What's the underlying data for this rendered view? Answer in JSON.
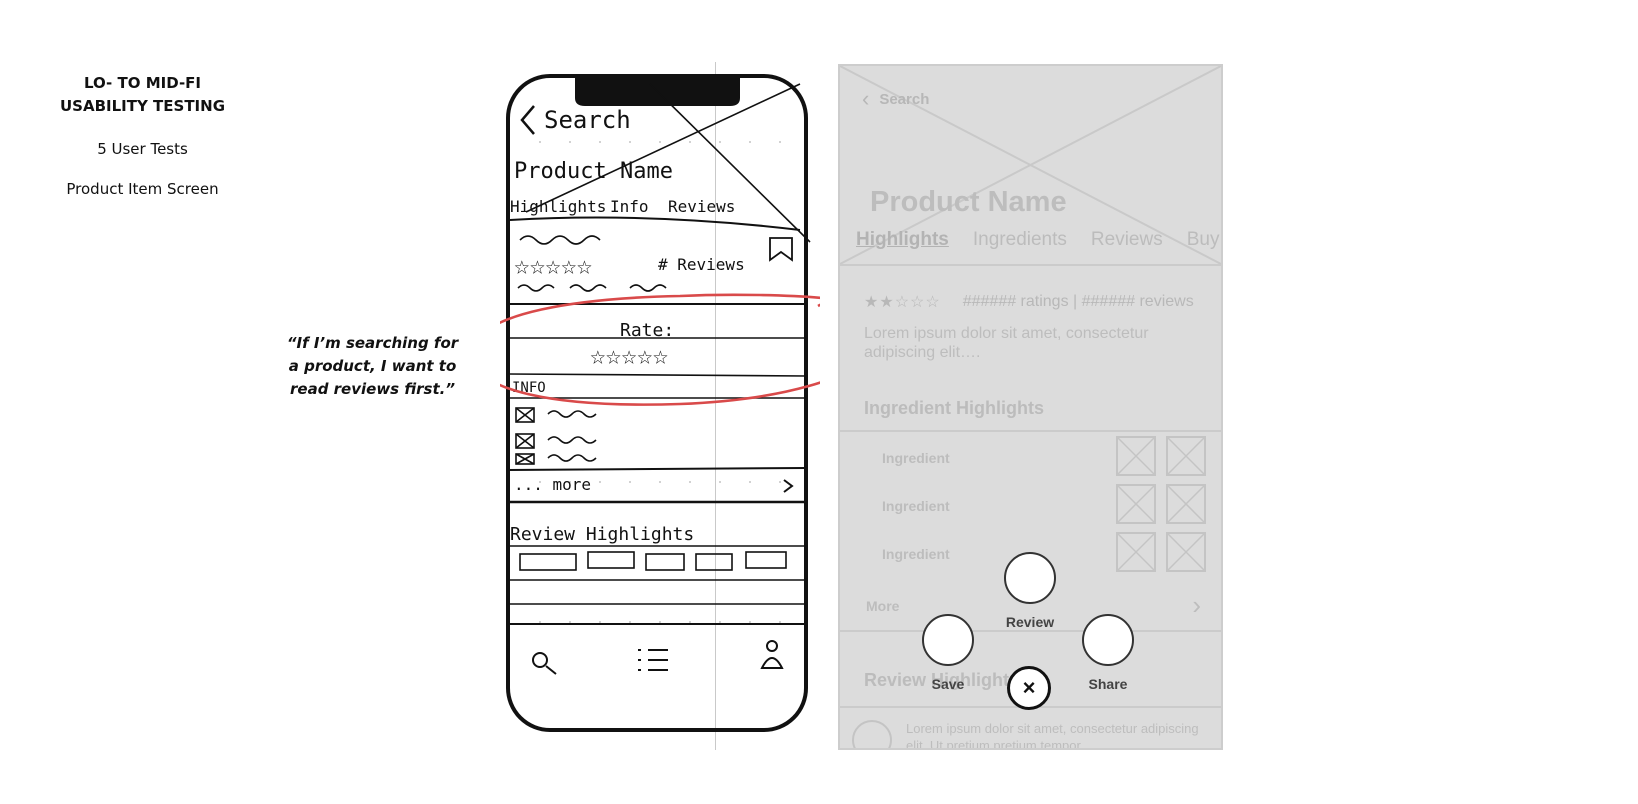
{
  "caption": {
    "title_line1": "LO- TO MID-FI",
    "title_line2": "USABILITY TESTING",
    "tests": "5 User Tests",
    "screen": "Product Item Screen"
  },
  "quote": {
    "line1": "“If I’m searching for",
    "line2": "a product, I want to",
    "line3": "read reviews first.”"
  },
  "sketch": {
    "back_label": "Search",
    "product_name": "Product Name",
    "tabs": [
      "Highlights",
      "Info",
      "Reviews"
    ],
    "reviews_label": "# Reviews",
    "rate_label": "Rate:",
    "info_label": "INFO",
    "more_label": "... more",
    "review_highlights_label": "Review Highlights",
    "highlight_color": "#d94a4a"
  },
  "wireframe": {
    "back_label": "Search",
    "product_name": "Product Name",
    "tabs": [
      "Highlights",
      "Ingredients",
      "Reviews",
      "Buy"
    ],
    "stars": "★★☆☆☆",
    "rating_text": "###### ratings | ###### reviews",
    "description": "Lorem ipsum dolor sit amet, consectetur adipiscing elit….",
    "ingredient_title": "Ingredient Highlights",
    "ingredients": [
      "Ingredient",
      "Ingredient",
      "Ingredient"
    ],
    "more_label": "More",
    "review_title": "Review Highlights",
    "review_text": "Lorem ipsum dolor sit amet, consectetur adipiscing elit. Ut pretium pretium tempor."
  },
  "fab_menu": {
    "review_label": "Review",
    "save_label": "Save",
    "share_label": "Share",
    "close_glyph": "×"
  }
}
